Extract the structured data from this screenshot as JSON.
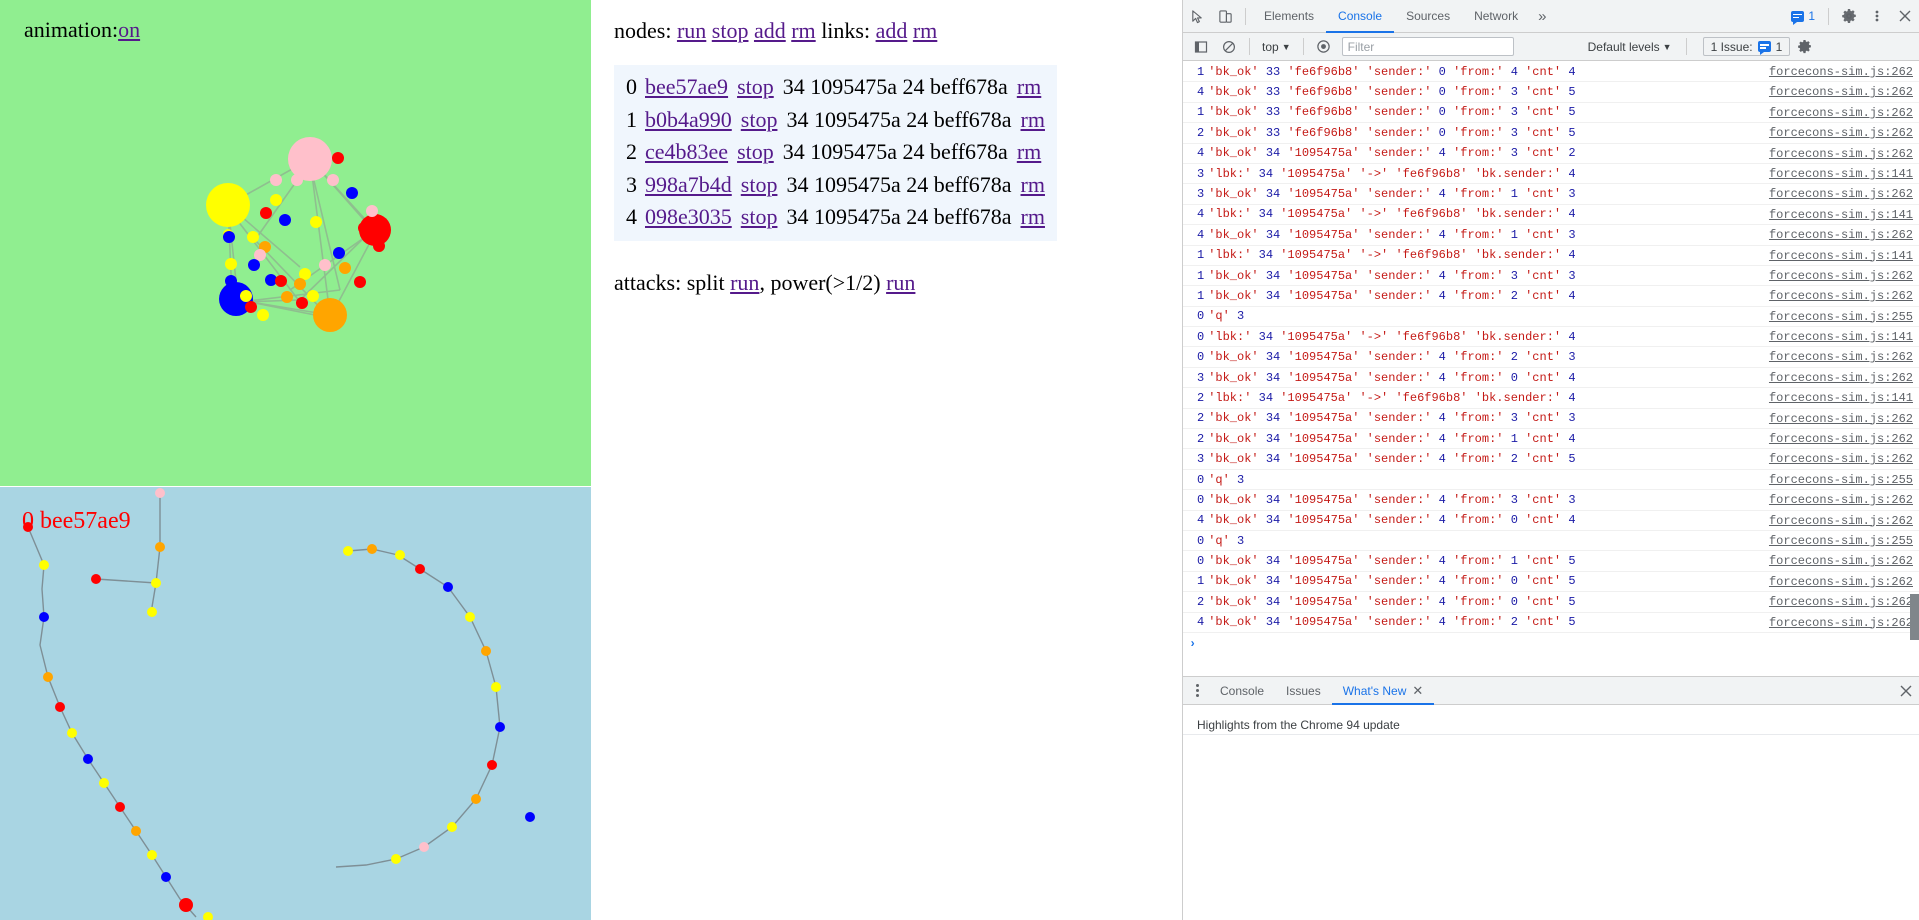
{
  "page": {
    "animation": {
      "label": "animation:",
      "value": "on"
    },
    "controls": {
      "nodes_label": "nodes:",
      "nodes_actions": [
        "run",
        "stop",
        "add",
        "rm"
      ],
      "links_label": "links:",
      "links_actions": [
        "add",
        "rm"
      ]
    },
    "node_table": {
      "rows": [
        {
          "index": "0",
          "hash": "bee57ae9",
          "stop": "stop",
          "values": "34 1095475a 24 beff678a",
          "rm": "rm"
        },
        {
          "index": "1",
          "hash": "b0b4a990",
          "stop": "stop",
          "values": "34 1095475a 24 beff678a",
          "rm": "rm"
        },
        {
          "index": "2",
          "hash": "ce4b83ee",
          "stop": "stop",
          "values": "34 1095475a 24 beff678a",
          "rm": "rm"
        },
        {
          "index": "3",
          "hash": "998a7b4d",
          "stop": "stop",
          "values": "34 1095475a 24 beff678a",
          "rm": "rm"
        },
        {
          "index": "4",
          "hash": "098e3035",
          "stop": "stop",
          "values": "34 1095475a 24 beff678a",
          "rm": "rm"
        }
      ]
    },
    "attacks": {
      "label": "attacks:",
      "split_label": "split",
      "split_run": "run",
      "comma": ",",
      "power_label": "power(>1/2)",
      "power_run": "run"
    },
    "chain_caption": "0 bee57ae9",
    "colors": {
      "sim_bg": "#90ee90",
      "chain_bg": "#a9d5e3",
      "link_visited": "#551a8b",
      "caption": "#ff0000",
      "row_bg": "#f0f6fd"
    }
  },
  "devtools": {
    "tabs": [
      {
        "label": "Elements",
        "active": false
      },
      {
        "label": "Console",
        "active": true
      },
      {
        "label": "Sources",
        "active": false
      },
      {
        "label": "Network",
        "active": false
      }
    ],
    "more_tabs": "»",
    "issue_count": "1",
    "filterbar": {
      "context": "top",
      "filter_placeholder": "Filter",
      "filter_value": "",
      "levels": "Default levels",
      "issues_label": "1 Issue:",
      "issues_count": "1"
    },
    "console": {
      "prompt": "›",
      "rows": [
        {
          "ctx": "1",
          "msg": "'bk_ok' 33 'fe6f96b8' 'sender:' 0 'from:' 4 'cnt' 4",
          "src": "forcecons-sim.js:262"
        },
        {
          "ctx": "4",
          "msg": "'bk_ok' 33 'fe6f96b8' 'sender:' 0 'from:' 3 'cnt' 5",
          "src": "forcecons-sim.js:262"
        },
        {
          "ctx": "1",
          "msg": "'bk_ok' 33 'fe6f96b8' 'sender:' 0 'from:' 3 'cnt' 5",
          "src": "forcecons-sim.js:262"
        },
        {
          "ctx": "2",
          "msg": "'bk_ok' 33 'fe6f96b8' 'sender:' 0 'from:' 3 'cnt' 5",
          "src": "forcecons-sim.js:262"
        },
        {
          "ctx": "4",
          "msg": "'bk_ok' 34 '1095475a' 'sender:' 4 'from:' 3 'cnt' 2",
          "src": "forcecons-sim.js:262"
        },
        {
          "ctx": "3",
          "msg": "'lbk:' 34 '1095475a' '->' 'fe6f96b8' 'bk.sender:' 4",
          "src": "forcecons-sim.js:141"
        },
        {
          "ctx": "3",
          "msg": "'bk_ok' 34 '1095475a' 'sender:' 4 'from:' 1 'cnt' 3",
          "src": "forcecons-sim.js:262"
        },
        {
          "ctx": "4",
          "msg": "'lbk:' 34 '1095475a' '->' 'fe6f96b8' 'bk.sender:' 4",
          "src": "forcecons-sim.js:141"
        },
        {
          "ctx": "4",
          "msg": "'bk_ok' 34 '1095475a' 'sender:' 4 'from:' 1 'cnt' 3",
          "src": "forcecons-sim.js:262"
        },
        {
          "ctx": "1",
          "msg": "'lbk:' 34 '1095475a' '->' 'fe6f96b8' 'bk.sender:' 4",
          "src": "forcecons-sim.js:141"
        },
        {
          "ctx": "1",
          "msg": "'bk_ok' 34 '1095475a' 'sender:' 4 'from:' 3 'cnt' 3",
          "src": "forcecons-sim.js:262"
        },
        {
          "ctx": "1",
          "msg": "'bk_ok' 34 '1095475a' 'sender:' 4 'from:' 2 'cnt' 4",
          "src": "forcecons-sim.js:262"
        },
        {
          "ctx": "0",
          "msg": "'q' 3",
          "src": "forcecons-sim.js:255"
        },
        {
          "ctx": "0",
          "msg": "'lbk:' 34 '1095475a' '->' 'fe6f96b8' 'bk.sender:' 4",
          "src": "forcecons-sim.js:141"
        },
        {
          "ctx": "0",
          "msg": "'bk_ok' 34 '1095475a' 'sender:' 4 'from:' 2 'cnt' 3",
          "src": "forcecons-sim.js:262"
        },
        {
          "ctx": "3",
          "msg": "'bk_ok' 34 '1095475a' 'sender:' 4 'from:' 0 'cnt' 4",
          "src": "forcecons-sim.js:262"
        },
        {
          "ctx": "2",
          "msg": "'lbk:' 34 '1095475a' '->' 'fe6f96b8' 'bk.sender:' 4",
          "src": "forcecons-sim.js:141"
        },
        {
          "ctx": "2",
          "msg": "'bk_ok' 34 '1095475a' 'sender:' 4 'from:' 3 'cnt' 3",
          "src": "forcecons-sim.js:262"
        },
        {
          "ctx": "2",
          "msg": "'bk_ok' 34 '1095475a' 'sender:' 4 'from:' 1 'cnt' 4",
          "src": "forcecons-sim.js:262"
        },
        {
          "ctx": "3",
          "msg": "'bk_ok' 34 '1095475a' 'sender:' 4 'from:' 2 'cnt' 5",
          "src": "forcecons-sim.js:262"
        },
        {
          "ctx": "0",
          "msg": "'q' 3",
          "src": "forcecons-sim.js:255"
        },
        {
          "ctx": "0",
          "msg": "'bk_ok' 34 '1095475a' 'sender:' 4 'from:' 3 'cnt' 3",
          "src": "forcecons-sim.js:262"
        },
        {
          "ctx": "4",
          "msg": "'bk_ok' 34 '1095475a' 'sender:' 4 'from:' 0 'cnt' 4",
          "src": "forcecons-sim.js:262"
        },
        {
          "ctx": "0",
          "msg": "'q' 3",
          "src": "forcecons-sim.js:255"
        },
        {
          "ctx": "0",
          "msg": "'bk_ok' 34 '1095475a' 'sender:' 4 'from:' 1 'cnt' 5",
          "src": "forcecons-sim.js:262"
        },
        {
          "ctx": "1",
          "msg": "'bk_ok' 34 '1095475a' 'sender:' 4 'from:' 0 'cnt' 5",
          "src": "forcecons-sim.js:262"
        },
        {
          "ctx": "2",
          "msg": "'bk_ok' 34 '1095475a' 'sender:' 4 'from:' 0 'cnt' 5",
          "src": "forcecons-sim.js:262"
        },
        {
          "ctx": "4",
          "msg": "'bk_ok' 34 '1095475a' 'sender:' 4 'from:' 2 'cnt' 5",
          "src": "forcecons-sim.js:262"
        }
      ]
    },
    "drawer": {
      "tabs": [
        {
          "label": "Console",
          "active": false,
          "closable": false
        },
        {
          "label": "Issues",
          "active": false,
          "closable": false
        },
        {
          "label": "What's New",
          "active": true,
          "closable": true
        }
      ],
      "content_title": "Highlights from the Chrome 94 update"
    },
    "colors": {
      "accent": "#1a73e8",
      "toolbar_bg": "#f1f3f4",
      "border": "#cdcdcd"
    }
  }
}
